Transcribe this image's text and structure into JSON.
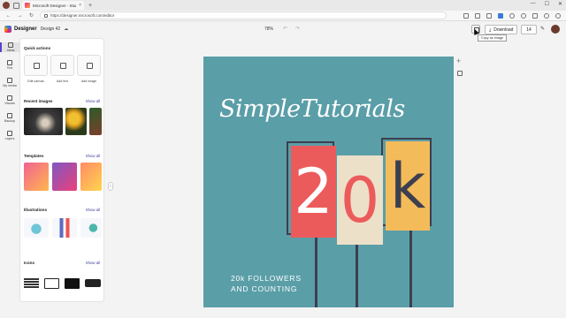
{
  "browser": {
    "tab_title": "Microsoft Designer - Stunning d...",
    "tab_close": "×",
    "new_tab": "+",
    "url": "https://designer.microsoft.com/editor",
    "back": "←",
    "forward": "→",
    "reload": "↻",
    "minimize": "—",
    "maximize": "☐",
    "close": "✕"
  },
  "header": {
    "app_name": "Designer",
    "doc_name": "Design 42",
    "zoom": "78%",
    "undo": "↶",
    "redo": "↷",
    "download_label": "Download",
    "share_label": "14",
    "tooltip": "Copy as image"
  },
  "rail": [
    {
      "label": "Ideas"
    },
    {
      "label": "Text"
    },
    {
      "label": "My media"
    },
    {
      "label": "Visuals"
    },
    {
      "label": "Backup"
    },
    {
      "label": "Layers"
    }
  ],
  "panel": {
    "quick_actions": {
      "title": "Quick actions",
      "items": [
        "Edit canvas",
        "Add text",
        "Add image"
      ]
    },
    "recent_images": {
      "title": "Recent images",
      "show_all": "Show all"
    },
    "templates": {
      "title": "Templates",
      "show_all": "Show all"
    },
    "illustrations": {
      "title": "Illustrations",
      "show_all": "Show all"
    },
    "icons": {
      "title": "Icons",
      "show_all": "Show all"
    },
    "collapse": "‹"
  },
  "design": {
    "title": "SimpleTutorials",
    "chars": [
      "2",
      "0",
      "k"
    ],
    "footer_line1": "20k FOLLOWERS",
    "footer_line2": "AND COUNTING",
    "colors": {
      "bg": "#5a9ea8",
      "red": "#ec5b5b",
      "cream": "#ece0c8",
      "yellow": "#f4bb5a",
      "pole": "#3d3f4f"
    }
  },
  "canvas_tools": {
    "add": "+"
  }
}
